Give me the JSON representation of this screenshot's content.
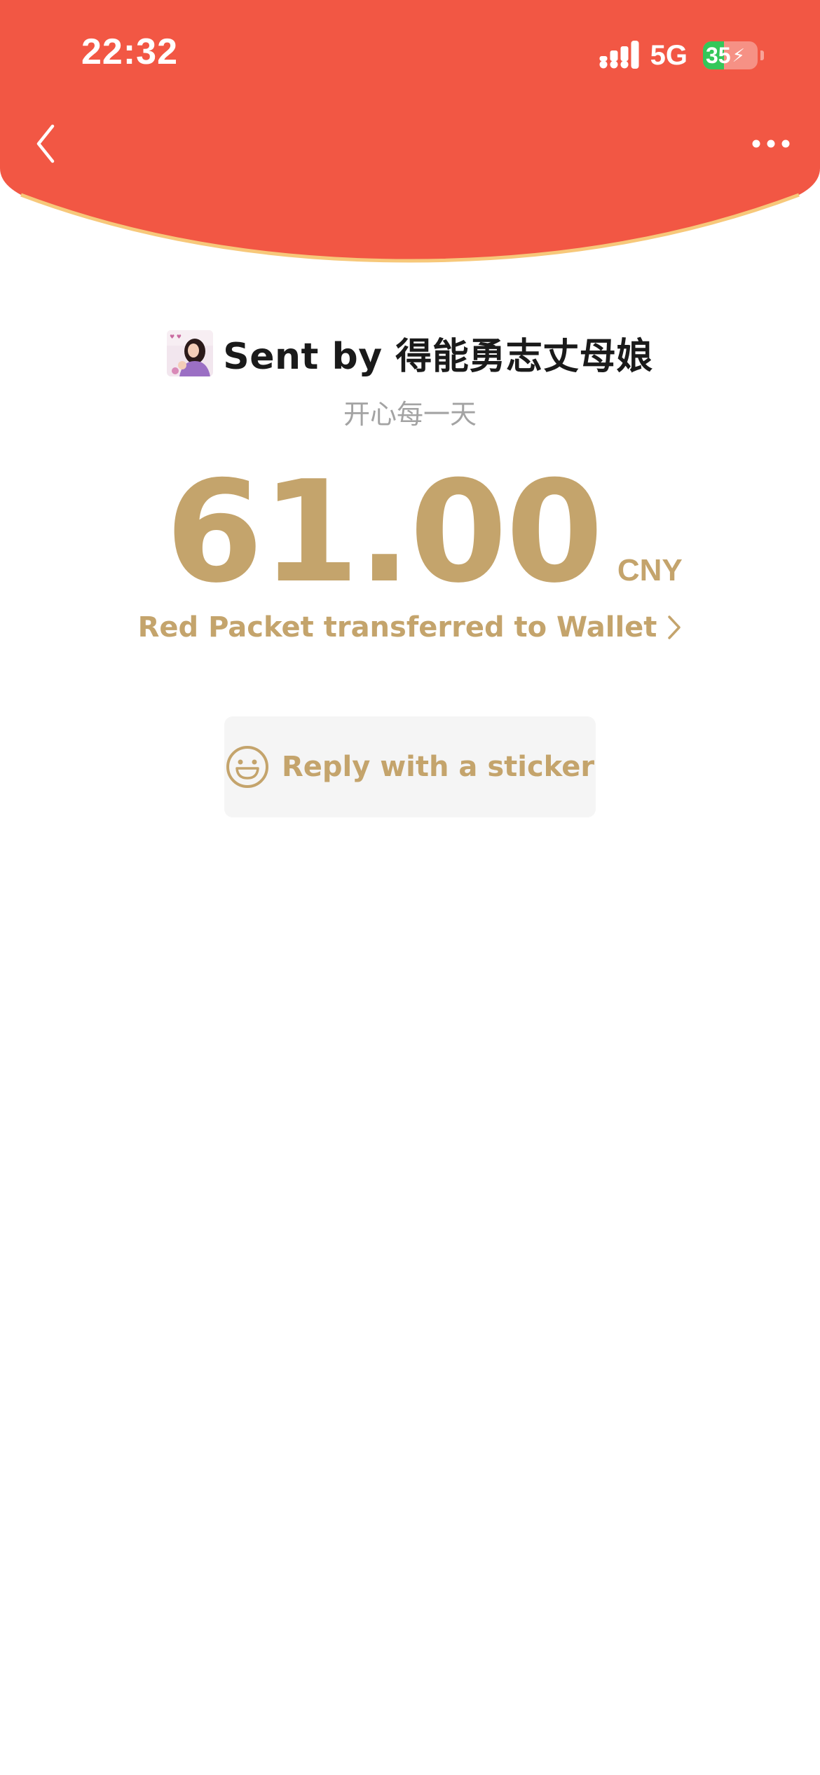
{
  "status_bar": {
    "time": "22:32",
    "network": "5G",
    "battery_level": "35",
    "battery_charging": true,
    "icons": {
      "signal": "signal-bars-icon",
      "battery": "battery-charging-icon"
    }
  },
  "nav": {
    "back_icon": "chevron-left-icon",
    "more_icon": "more-dots-icon"
  },
  "red_packet": {
    "sender_label": "Sent by 得能勇志丈母娘",
    "avatar": "sender-avatar",
    "greeting": "开心每一天",
    "amount": "61.00",
    "currency": "CNY",
    "wallet_link": "Red Packet transferred to Wallet",
    "reply_button": "Reply with a sticker"
  },
  "colors": {
    "header_red": "#f25744",
    "header_edge": "#f7c87a",
    "gold": "#c4a46c",
    "greeting_gray": "#a3a3a3",
    "button_bg": "#f5f5f5"
  }
}
